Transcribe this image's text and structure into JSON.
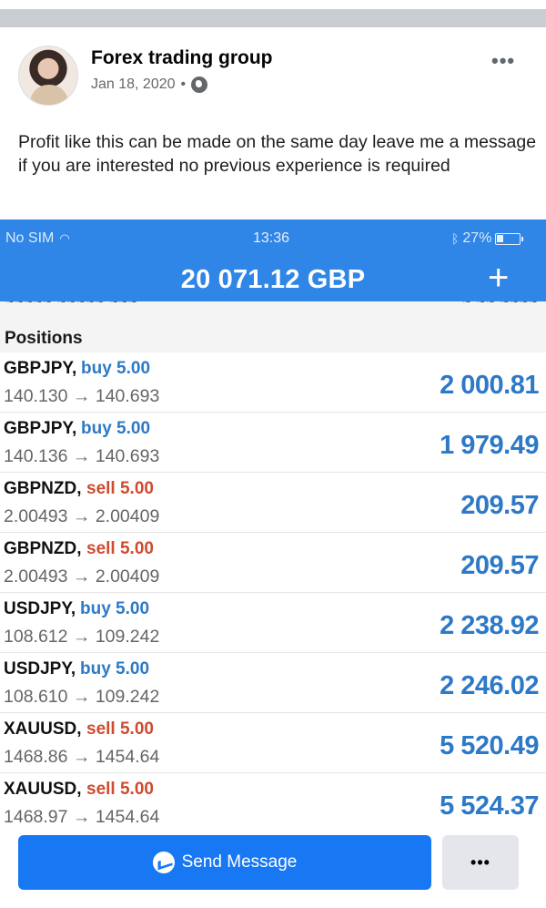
{
  "post": {
    "group_name": "Forex trading group",
    "date": "Jan 18, 2020",
    "separator": "•",
    "privacy_icon": "globe-icon",
    "more_icon": "•••",
    "text": "Profit like this can be made on the same day leave me a message if you are interested no previous experience is required"
  },
  "phone": {
    "status": {
      "carrier": "No SIM",
      "time": "13:36",
      "battery": "27%"
    },
    "balance": "20 071.12 GBP",
    "plus_icon": "+",
    "section_title": "Positions",
    "positions": [
      {
        "symbol": "GBPJPY,",
        "direction": "buy 5.00",
        "type": "buy",
        "prices": "140.130 → 140.693",
        "profit": "2 000.81"
      },
      {
        "symbol": "GBPJPY,",
        "direction": "buy 5.00",
        "type": "buy",
        "prices": "140.136 → 140.693",
        "profit": "1 979.49"
      },
      {
        "symbol": "GBPNZD,",
        "direction": "sell 5.00",
        "type": "sell",
        "prices": "2.00493 → 2.00409",
        "profit": "209.57"
      },
      {
        "symbol": "GBPNZD,",
        "direction": "sell 5.00",
        "type": "sell",
        "prices": "2.00493 → 2.00409",
        "profit": "209.57"
      },
      {
        "symbol": "USDJPY,",
        "direction": "buy 5.00",
        "type": "buy",
        "prices": "108.612 → 109.242",
        "profit": "2 238.92"
      },
      {
        "symbol": "USDJPY,",
        "direction": "buy 5.00",
        "type": "buy",
        "prices": "108.610 → 109.242",
        "profit": "2 246.02"
      },
      {
        "symbol": "XAUUSD,",
        "direction": "sell 5.00",
        "type": "sell",
        "prices": "1468.86 → 1454.64",
        "profit": "5 520.49"
      },
      {
        "symbol": "XAUUSD,",
        "direction": "sell 5.00",
        "type": "sell",
        "prices": "1468.97 → 1454.64",
        "profit": "5 524.37"
      }
    ]
  },
  "footer": {
    "send_label": "Send Message",
    "more_label": "•••"
  },
  "colors": {
    "phone_blue": "#2f86e6",
    "buy": "#2d79c7",
    "sell": "#d04a2f",
    "fb_blue": "#1877f2"
  }
}
